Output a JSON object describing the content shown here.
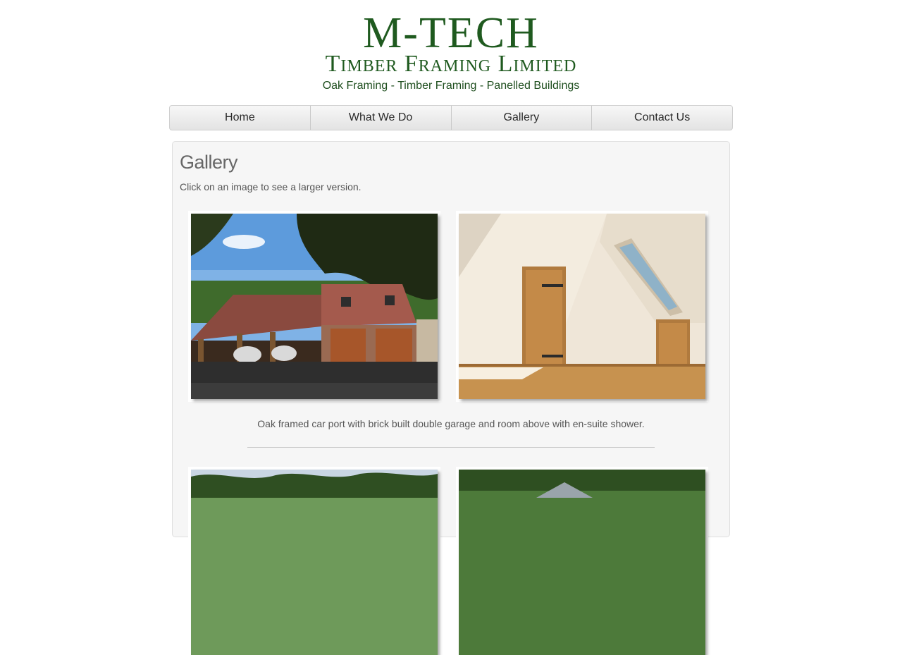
{
  "header": {
    "title": "M-TECH",
    "subtitle": "Timber Framing Limited",
    "tagline": "Oak Framing - Timber Framing - Panelled Buildings"
  },
  "nav": {
    "items": [
      {
        "label": "Home"
      },
      {
        "label": "What We Do"
      },
      {
        "label": "Gallery"
      },
      {
        "label": "Contact Us"
      }
    ]
  },
  "main": {
    "title": "Gallery",
    "intro": "Click on an image to see a larger version.",
    "rows": [
      {
        "caption": "Oak framed car port with brick built double garage and room above with en-suite shower.",
        "images": [
          {
            "icon": "garage-carport-photo"
          },
          {
            "icon": "attic-room-photo"
          }
        ]
      },
      {
        "images": [
          {
            "icon": "garden-building-photo"
          },
          {
            "icon": "roof-building-photo"
          }
        ]
      }
    ]
  },
  "colors": {
    "brand_green": "#1f5a1f",
    "panel_bg": "#f6f6f6"
  }
}
